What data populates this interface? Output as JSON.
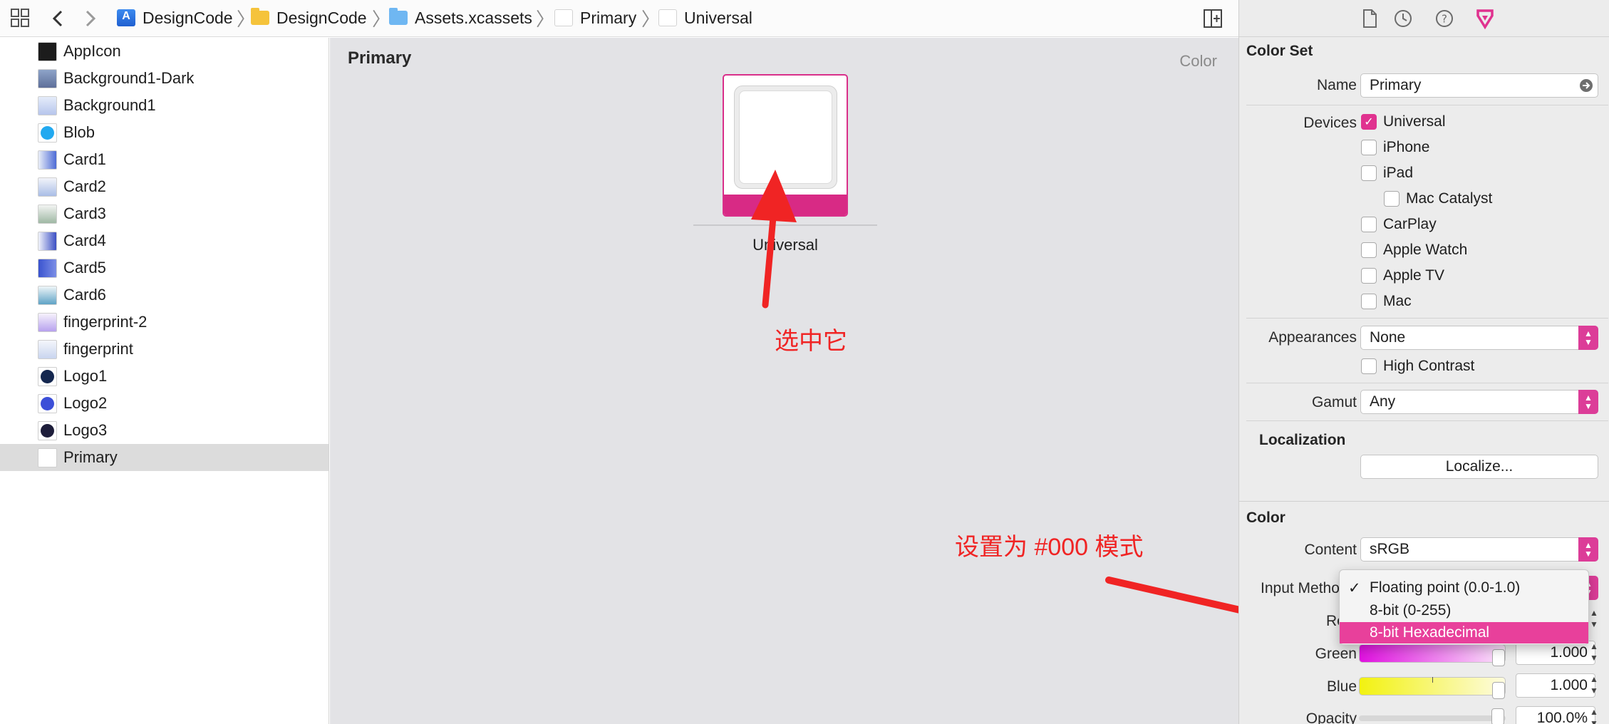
{
  "pathbar": {
    "crumbs": [
      "DesignCode",
      "DesignCode",
      "Assets.xcassets",
      "Primary",
      "Universal"
    ]
  },
  "navigator": {
    "items": [
      "AppIcon",
      "Background1-Dark",
      "Background1",
      "Blob",
      "Card1",
      "Card2",
      "Card3",
      "Card4",
      "Card5",
      "Card6",
      "fingerprint-2",
      "fingerprint",
      "Logo1",
      "Logo2",
      "Logo3",
      "Primary"
    ],
    "selected": "Primary"
  },
  "canvas": {
    "title": "Primary",
    "type_label": "Color",
    "swatch_label": "Universal",
    "swatch_color": "#d82a85"
  },
  "annotations": {
    "select_it": "选中它",
    "set_mode": "设置为 #000 模式"
  },
  "inspector": {
    "color_set_header": "Color Set",
    "name_label": "Name",
    "name_value": "Primary",
    "devices_label": "Devices",
    "devices": [
      {
        "label": "Universal",
        "checked": true
      },
      {
        "label": "iPhone",
        "checked": false
      },
      {
        "label": "iPad",
        "checked": false
      },
      {
        "label": "Mac Catalyst",
        "checked": false
      },
      {
        "label": "CarPlay",
        "checked": false
      },
      {
        "label": "Apple Watch",
        "checked": false
      },
      {
        "label": "Apple TV",
        "checked": false
      },
      {
        "label": "Mac",
        "checked": false
      }
    ],
    "appearances_label": "Appearances",
    "appearances_value": "None",
    "high_contrast_label": "High Contrast",
    "gamut_label": "Gamut",
    "gamut_value": "Any",
    "localization_header": "Localization",
    "localize_button": "Localize...",
    "color_header": "Color",
    "content_label": "Content",
    "content_value": "sRGB",
    "input_method_label": "Input Metho",
    "red_label": "Re",
    "green_label": "Green",
    "green_value": "1.000",
    "blue_label": "Blue",
    "blue_value": "1.000",
    "opacity_label": "Opacity",
    "opacity_value": "100.0%",
    "input_method_menu": [
      {
        "label": "Floating point (0.0-1.0)",
        "checked": true,
        "highlighted": false
      },
      {
        "label": "8-bit (0-255)",
        "checked": false,
        "highlighted": false
      },
      {
        "label": "8-bit Hexadecimal",
        "checked": false,
        "highlighted": true
      }
    ],
    "menu_checkmark": "✓",
    "accent_color": "#e0328f"
  }
}
